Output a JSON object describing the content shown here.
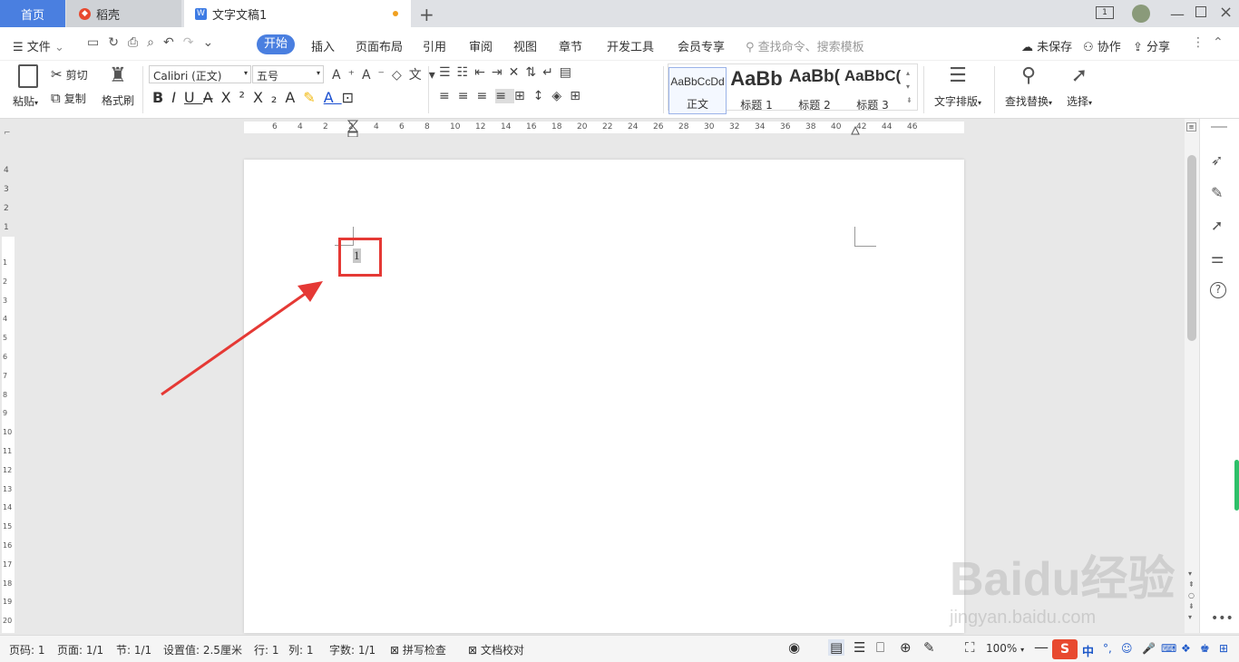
{
  "tabs": {
    "home": "首页",
    "daoke": "稻壳",
    "doc": "文字文稿1",
    "add": "+"
  },
  "menu": {
    "file": "文件",
    "items": [
      "开始",
      "插入",
      "页面布局",
      "引用",
      "审阅",
      "视图",
      "章节",
      "开发工具",
      "会员专享"
    ],
    "search_placeholder": "查找命令、搜索模板",
    "unsaved": "未保存",
    "collab": "协作",
    "share": "分享"
  },
  "ribbon": {
    "paste": "粘贴",
    "cut": "剪切",
    "copy": "复制",
    "format_painter": "格式刷",
    "font_name": "Calibri (正文)",
    "font_size": "五号",
    "styles": [
      {
        "preview": "AaBbCcDd",
        "name": "正文"
      },
      {
        "preview": "AaBb",
        "name": "标题 1"
      },
      {
        "preview": "AaBb(",
        "name": "标题 2"
      },
      {
        "preview": "AaBbC(",
        "name": "标题 3"
      }
    ],
    "text_layout": "文字排版",
    "find_replace": "查找替换",
    "select": "选择"
  },
  "ruler": {
    "h_ticks": [
      "6",
      "4",
      "2",
      "2",
      "4",
      "6",
      "8",
      "10",
      "12",
      "14",
      "16",
      "18",
      "20",
      "22",
      "24",
      "26",
      "28",
      "30",
      "32",
      "34",
      "36",
      "38",
      "40",
      "42",
      "44",
      "46"
    ],
    "v_ticks_top": [
      "4",
      "3",
      "2",
      "1"
    ],
    "v_ticks": [
      "1",
      "2",
      "3",
      "4",
      "5",
      "6",
      "7",
      "8",
      "9",
      "10",
      "11",
      "12",
      "13",
      "14",
      "15",
      "16",
      "17",
      "18",
      "19",
      "20"
    ]
  },
  "document": {
    "content": "1"
  },
  "status": {
    "page_num": "页码: 1",
    "pages": "页面: 1/1",
    "section": "节: 1/1",
    "setting": "设置值: 2.5厘米",
    "row": "行: 1",
    "col": "列: 1",
    "word_count": "字数: 1/1",
    "spell_check": "拼写检查",
    "proofread": "文档校对",
    "zoom": "100%",
    "ime": "中"
  },
  "watermark": {
    "brand": "Baidu经验",
    "url": "jingyan.baidu.com"
  },
  "colors": {
    "accent": "#4a7fe0",
    "annotation": "#e53935",
    "daoke": "#e8492f"
  }
}
